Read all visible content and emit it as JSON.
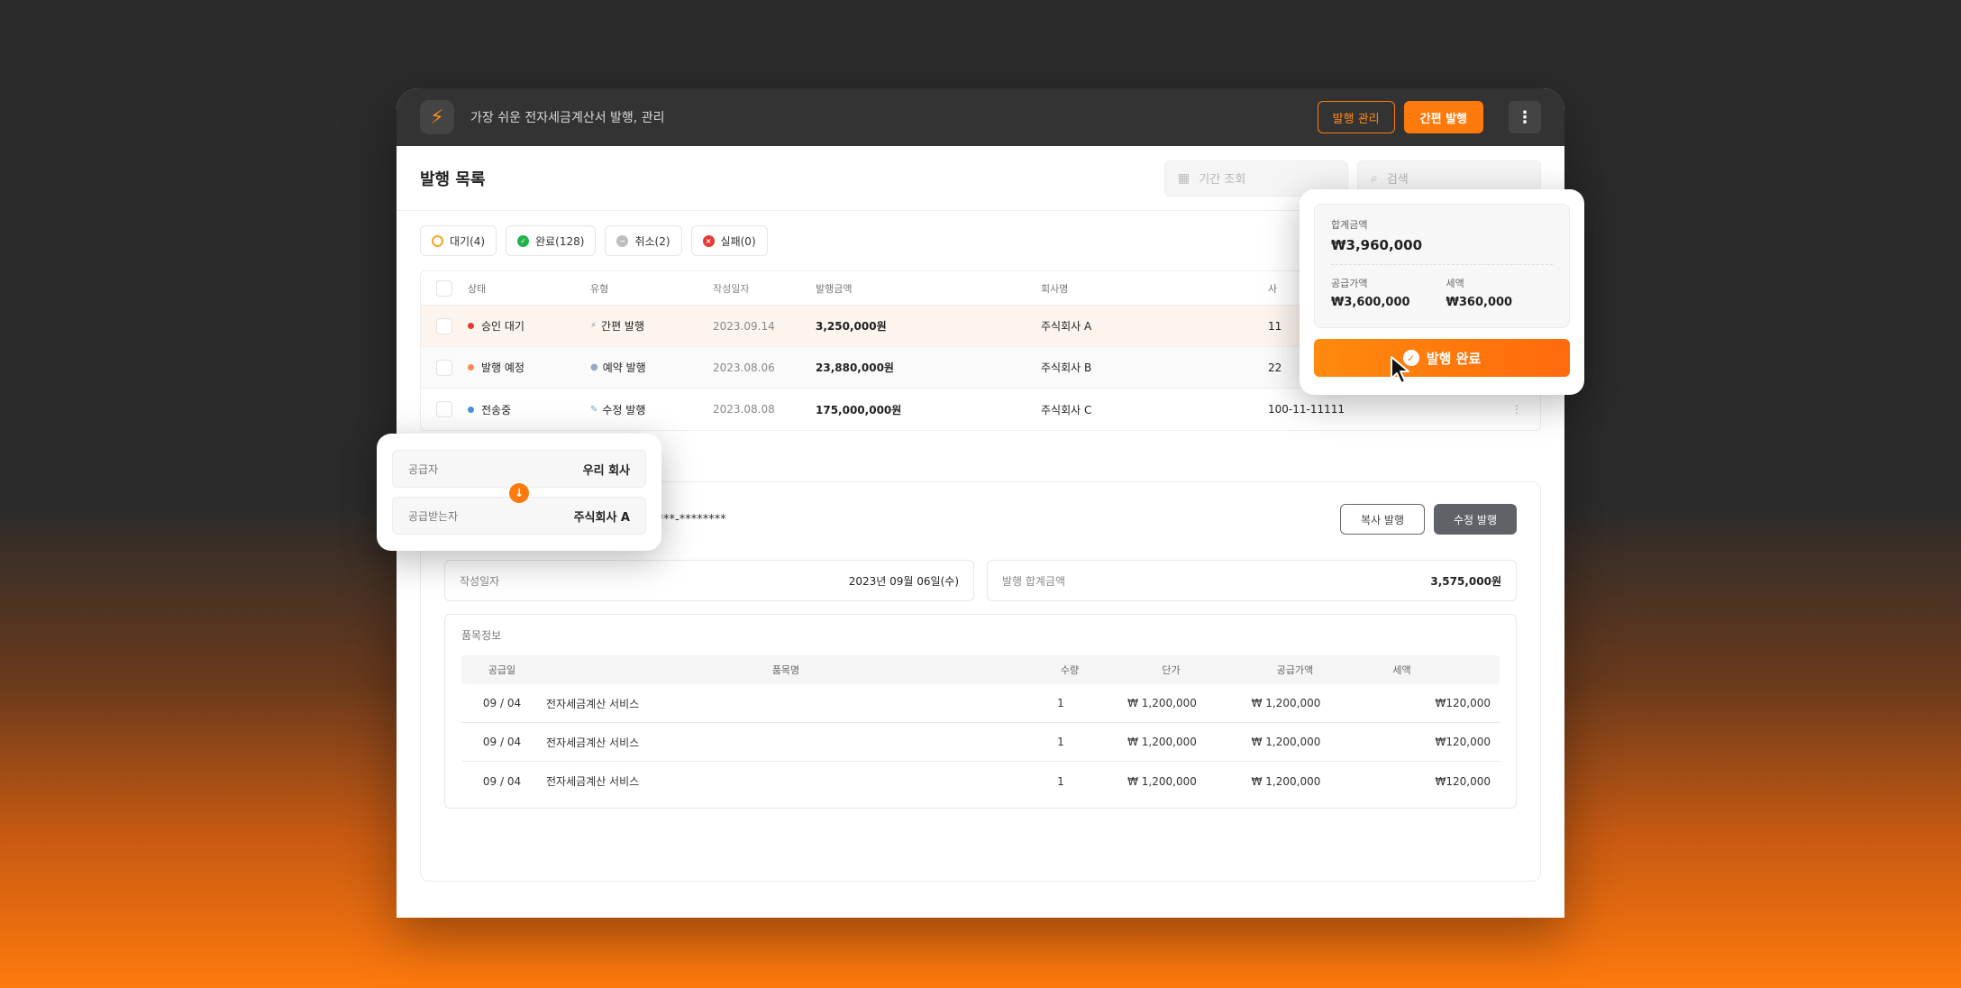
{
  "app": {
    "title": "가장 쉬운 전자세금계산서 발행, 관리",
    "logo_glyph": "⚡"
  },
  "topbar": {
    "manage_label": "발행 관리",
    "quick_issue_label": "간편 발행",
    "more_glyph": "⋮"
  },
  "list": {
    "title": "발행 목록",
    "date_placeholder": "기간 조회",
    "search_placeholder": "검색"
  },
  "filters": [
    {
      "label": "대기(4)"
    },
    {
      "label": "완료(128)"
    },
    {
      "label": "취소(2)"
    },
    {
      "label": "실패(0)"
    }
  ],
  "table": {
    "headers": [
      "상태",
      "유형",
      "작성일자",
      "발행금액",
      "회사명",
      "사"
    ],
    "rows": [
      {
        "status": "승인 대기",
        "status_color": "#e53935",
        "type": "간편 발행",
        "type_icon": "⚡",
        "date": "2023.09.14",
        "amount": "3,250,000원",
        "company": "주식회사 A",
        "bizno": "11"
      },
      {
        "status": "발행 예정",
        "status_color": "#ff8a50",
        "type": "예약 발행",
        "type_icon": "●",
        "date": "2023.08.06",
        "amount": "23,880,000원",
        "company": "주식회사 B",
        "bizno": "22"
      },
      {
        "status": "전송중",
        "status_color": "#4a90e2",
        "type": "수정 발행",
        "type_icon": "✎",
        "date": "2023.08.08",
        "amount": "175,000,000원",
        "company": "주식회사 C",
        "bizno": "100-11-11111"
      }
    ]
  },
  "detail": {
    "masked_no": "****-********",
    "copy_label": "복사 발행",
    "modify_label": "수정 발행",
    "write_date_label": "작성일자",
    "write_date_value": "2023년 09월 06일(수)",
    "total_label": "발행 합계금액",
    "total_value": "3,575,000원",
    "items_label": "품목정보",
    "item_headers": [
      "공급일",
      "품목명",
      "수량",
      "단가",
      "공급가액",
      "세액"
    ],
    "items": [
      {
        "date": "09 / 04",
        "name": "전자세금계산 서비스",
        "qty": "1",
        "unit": "₩ 1,200,000",
        "supply": "₩ 1,200,000",
        "tax": "₩120,000"
      },
      {
        "date": "09 / 04",
        "name": "전자세금계산 서비스",
        "qty": "1",
        "unit": "₩ 1,200,000",
        "supply": "₩ 1,200,000",
        "tax": "₩120,000"
      },
      {
        "date": "09 / 04",
        "name": "전자세금계산 서비스",
        "qty": "1",
        "unit": "₩ 1,200,000",
        "supply": "₩ 1,200,000",
        "tax": "₩120,000"
      }
    ]
  },
  "summary": {
    "total_label": "합계금액",
    "total_value": "₩3,960,000",
    "supply_label": "공급가액",
    "supply_value": "₩3,600,000",
    "tax_label": "세액",
    "tax_value": "₩360,000",
    "complete_label": "발행 완료"
  },
  "parties": {
    "supplier_label": "공급자",
    "supplier_value": "우리 회사",
    "receiver_label": "공급받는자",
    "receiver_value": "주식회사 A"
  },
  "colors": {
    "accent": "#ff7a0d",
    "topbar": "#333333"
  }
}
